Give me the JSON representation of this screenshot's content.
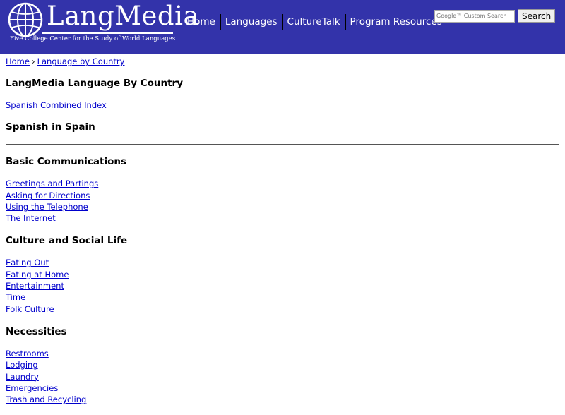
{
  "header": {
    "logo_text": "LangMedia",
    "tagline": "Five College Center for the Study of World Languages",
    "nav": [
      "Home",
      "Languages",
      "CultureTalk",
      "Program Resources"
    ],
    "search": {
      "placeholder": "Google™ Custom Search",
      "button_label": "Search"
    }
  },
  "breadcrumb": {
    "home": "Home",
    "separator": "›",
    "current": "Language by Country"
  },
  "page_title": "LangMedia Language By Country",
  "index_link": "Spanish Combined Index",
  "region_title": "Spanish in Spain",
  "sections": [
    {
      "title": "Basic Communications",
      "links": [
        "Greetings and Partings",
        "Asking for Directions",
        "Using the Telephone",
        "The Internet"
      ]
    },
    {
      "title": "Culture and Social Life",
      "links": [
        "Eating Out",
        "Eating at Home",
        "Entertainment",
        "Time",
        "Folk Culture"
      ]
    },
    {
      "title": "Necessities",
      "links": [
        "Restrooms",
        "Lodging",
        "Laundry",
        "Emergencies",
        "Trash and Recycling"
      ]
    }
  ],
  "colors": {
    "header_bg": "#3333aa",
    "link": "#0000cc"
  }
}
